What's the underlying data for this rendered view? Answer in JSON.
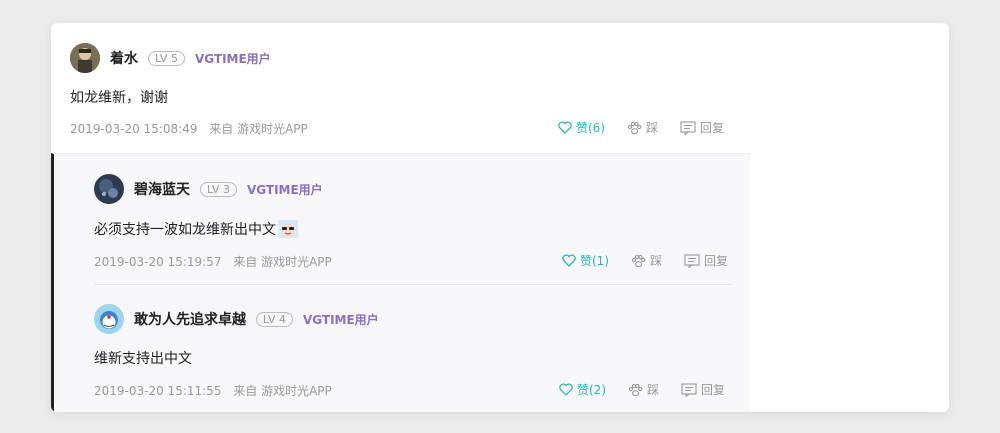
{
  "main_comment": {
    "user": "着水",
    "level": "LV 5",
    "tag": "VGTIME用户",
    "text": "如龙维新，谢谢",
    "time": "2019-03-20 15:08:49",
    "source": "来自 游戏时光APP",
    "like_label": "赞(6)",
    "dislike_label": "踩",
    "reply_label": "回复"
  },
  "replies": [
    {
      "user": "碧海蓝天",
      "level": "LV 3",
      "tag": "VGTIME用户",
      "text": "必须支持一波如龙维新出中文",
      "time": "2019-03-20 15:19:57",
      "source": "来自 游戏时光APP",
      "like_label": "赞(1)",
      "dislike_label": "踩",
      "reply_label": "回复"
    },
    {
      "user": "敢为人先追求卓越",
      "level": "LV 4",
      "tag": "VGTIME用户",
      "text": "维新支持出中文",
      "time": "2019-03-20 15:11:55",
      "source": "来自 游戏时光APP",
      "like_label": "赞(2)",
      "dislike_label": "踩",
      "reply_label": "回复"
    }
  ],
  "colors": {
    "accent": "#2ab7b2",
    "user_tag": "#8b6fc0",
    "meta": "#999999",
    "thread_bg": "#f7f7f9"
  },
  "icons": {
    "like": "heart-icon",
    "dislike": "paw-icon",
    "reply": "reply-icon"
  }
}
